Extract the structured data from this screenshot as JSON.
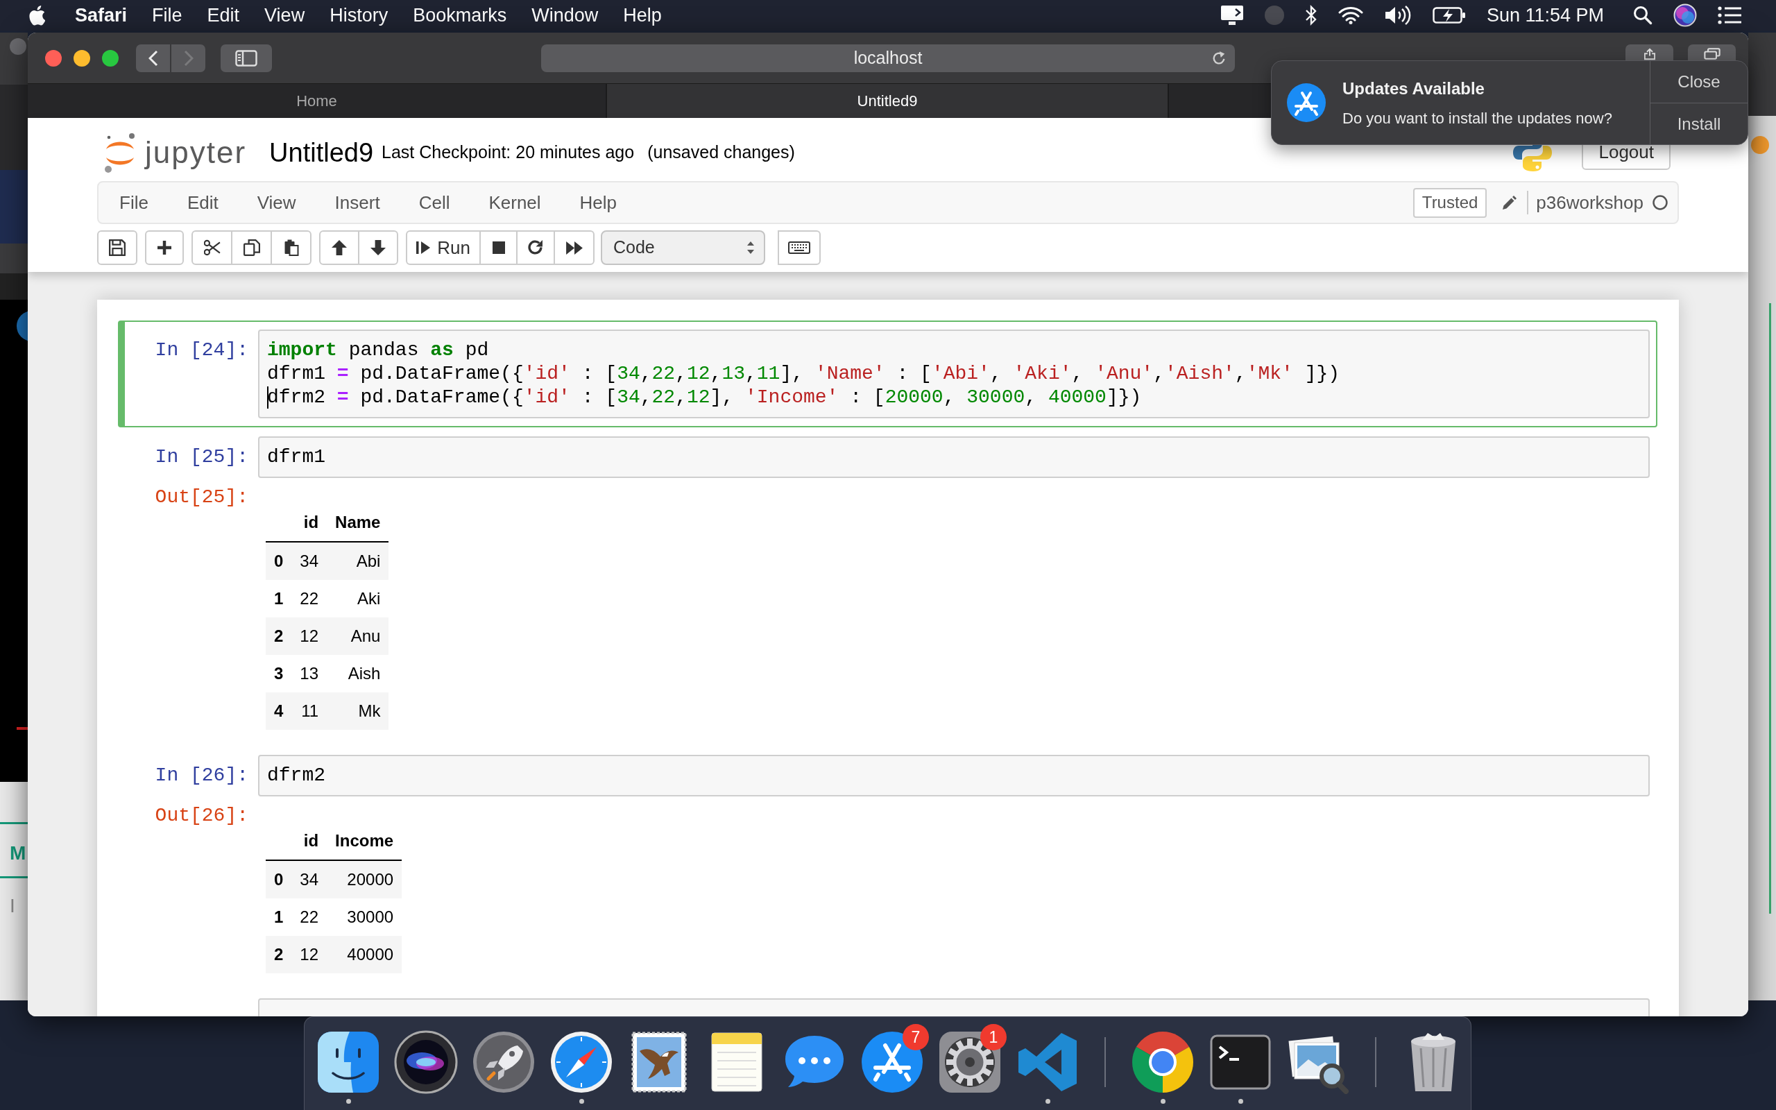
{
  "menu_bar": {
    "app": "Safari",
    "items": [
      "File",
      "Edit",
      "View",
      "History",
      "Bookmarks",
      "Window",
      "Help"
    ],
    "clock": "Sun 11:54 PM"
  },
  "background_window": {
    "texts": [
      "M",
      "I"
    ]
  },
  "browser": {
    "back_enabled": true,
    "forward_enabled": false,
    "address": "localhost",
    "tabs": [
      {
        "label": "Home",
        "selected": false
      },
      {
        "label": "Untitled9",
        "selected": true
      }
    ]
  },
  "notification": {
    "title": "Updates Available",
    "message": "Do you want to install the updates now?",
    "buttons": [
      "Close",
      "Install"
    ]
  },
  "jupyter": {
    "logo_text": "jupyter",
    "notebook_name": "Untitled9",
    "checkpoint": "Last Checkpoint: 20 minutes ago",
    "save_status": "(unsaved changes)",
    "logout": "Logout",
    "menus": [
      "File",
      "Edit",
      "View",
      "Insert",
      "Cell",
      "Kernel",
      "Help"
    ],
    "trusted": "Trusted",
    "kernel_name": "p36workshop",
    "kernel_busy": false,
    "toolbar": {
      "groups": [
        {
          "buttons": [
            {
              "kind": "save"
            }
          ]
        },
        {
          "buttons": [
            {
              "kind": "insert"
            }
          ]
        },
        {
          "buttons": [
            {
              "kind": "cut"
            },
            {
              "kind": "copy"
            },
            {
              "kind": "paste"
            }
          ]
        },
        {
          "buttons": [
            {
              "kind": "move-up"
            },
            {
              "kind": "move-down"
            }
          ]
        },
        {
          "buttons": [
            {
              "kind": "run"
            },
            {
              "kind": "interrupt"
            },
            {
              "kind": "restart"
            },
            {
              "kind": "run-all"
            }
          ]
        }
      ],
      "run_label": "Run",
      "cell_type": "Code"
    }
  },
  "cells": [
    {
      "prompt": "In [24]:",
      "selected": true,
      "lines": [
        {
          "cursor": false,
          "tokens": [
            {
              "kind": "keyword",
              "text": "import"
            },
            {
              "kind": "plain",
              "text": " pandas "
            },
            {
              "kind": "keyword",
              "text": "as"
            },
            {
              "kind": "plain",
              "text": " pd"
            }
          ]
        },
        {
          "cursor": false,
          "tokens": [
            {
              "kind": "plain",
              "text": "dfrm1 "
            },
            {
              "kind": "operator",
              "text": "="
            },
            {
              "kind": "plain",
              "text": " pd.DataFrame({"
            },
            {
              "kind": "string",
              "text": "'id'"
            },
            {
              "kind": "plain",
              "text": " : ["
            },
            {
              "kind": "number",
              "text": "34"
            },
            {
              "kind": "plain",
              "text": ","
            },
            {
              "kind": "number",
              "text": "22"
            },
            {
              "kind": "plain",
              "text": ","
            },
            {
              "kind": "number",
              "text": "12"
            },
            {
              "kind": "plain",
              "text": ","
            },
            {
              "kind": "number",
              "text": "13"
            },
            {
              "kind": "plain",
              "text": ","
            },
            {
              "kind": "number",
              "text": "11"
            },
            {
              "kind": "plain",
              "text": "], "
            },
            {
              "kind": "string",
              "text": "'Name'"
            },
            {
              "kind": "plain",
              "text": " : ["
            },
            {
              "kind": "string",
              "text": "'Abi'"
            },
            {
              "kind": "plain",
              "text": ", "
            },
            {
              "kind": "string",
              "text": "'Aki'"
            },
            {
              "kind": "plain",
              "text": ", "
            },
            {
              "kind": "string",
              "text": "'Anu'"
            },
            {
              "kind": "plain",
              "text": ","
            },
            {
              "kind": "string",
              "text": "'Aish'"
            },
            {
              "kind": "plain",
              "text": ","
            },
            {
              "kind": "string",
              "text": "'Mk'"
            },
            {
              "kind": "plain",
              "text": " ]})"
            }
          ]
        },
        {
          "cursor": true,
          "tokens": [
            {
              "kind": "plain",
              "text": "dfrm2 "
            },
            {
              "kind": "operator",
              "text": "="
            },
            {
              "kind": "plain",
              "text": " pd.DataFrame({"
            },
            {
              "kind": "string",
              "text": "'id'"
            },
            {
              "kind": "plain",
              "text": " : ["
            },
            {
              "kind": "number",
              "text": "34"
            },
            {
              "kind": "plain",
              "text": ","
            },
            {
              "kind": "number",
              "text": "22"
            },
            {
              "kind": "plain",
              "text": ","
            },
            {
              "kind": "number",
              "text": "12"
            },
            {
              "kind": "plain",
              "text": "], "
            },
            {
              "kind": "string",
              "text": "'Income'"
            },
            {
              "kind": "plain",
              "text": " : ["
            },
            {
              "kind": "number",
              "text": "20000"
            },
            {
              "kind": "plain",
              "text": ", "
            },
            {
              "kind": "number",
              "text": "30000"
            },
            {
              "kind": "plain",
              "text": ", "
            },
            {
              "kind": "number",
              "text": "40000"
            },
            {
              "kind": "plain",
              "text": "]})"
            }
          ]
        }
      ]
    },
    {
      "prompt": "In [25]:",
      "selected": false,
      "lines": [
        {
          "cursor": false,
          "tokens": [
            {
              "kind": "plain",
              "text": "dfrm1"
            }
          ]
        }
      ],
      "output": {
        "prompt": "Out[25]:",
        "table": {
          "columns": [
            "id",
            "Name"
          ],
          "rows": [
            {
              "index": "0",
              "values": [
                "34",
                "Abi"
              ]
            },
            {
              "index": "1",
              "values": [
                "22",
                "Aki"
              ]
            },
            {
              "index": "2",
              "values": [
                "12",
                "Anu"
              ]
            },
            {
              "index": "3",
              "values": [
                "13",
                "Aish"
              ]
            },
            {
              "index": "4",
              "values": [
                "11",
                "Mk"
              ]
            }
          ]
        }
      }
    },
    {
      "prompt": "In [26]:",
      "selected": false,
      "lines": [
        {
          "cursor": false,
          "tokens": [
            {
              "kind": "plain",
              "text": "dfrm2"
            }
          ]
        }
      ],
      "output": {
        "prompt": "Out[26]:",
        "table": {
          "columns": [
            "id",
            "Income"
          ],
          "rows": [
            {
              "index": "0",
              "values": [
                "34",
                "20000"
              ]
            },
            {
              "index": "1",
              "values": [
                "22",
                "30000"
              ]
            },
            {
              "index": "2",
              "values": [
                "12",
                "40000"
              ]
            }
          ]
        }
      }
    },
    {
      "selected": false
    }
  ],
  "dock": {
    "items": [
      {
        "kind": "finder",
        "running": true
      },
      {
        "kind": "assistant",
        "running": false
      },
      {
        "kind": "launcher",
        "running": false
      },
      {
        "kind": "compass",
        "running": true
      },
      {
        "kind": "mail",
        "running": false
      },
      {
        "kind": "notes",
        "running": false
      },
      {
        "kind": "messages",
        "running": false
      },
      {
        "kind": "store",
        "running": false,
        "badge": "7"
      },
      {
        "kind": "settings",
        "running": false,
        "badge": "1"
      },
      {
        "kind": "code-editor",
        "running": true
      },
      {
        "kind": "separator"
      },
      {
        "kind": "web-browser",
        "running": true
      },
      {
        "kind": "terminal",
        "running": true
      },
      {
        "kind": "photo-viewer",
        "running": false
      },
      {
        "kind": "separator"
      },
      {
        "kind": "trash",
        "running": false
      }
    ]
  }
}
